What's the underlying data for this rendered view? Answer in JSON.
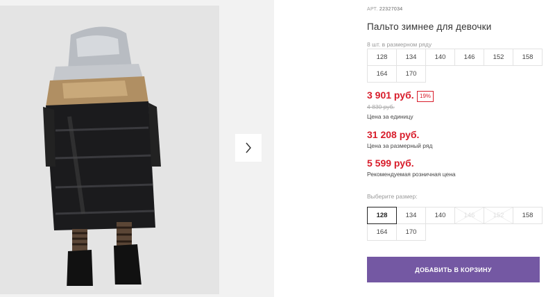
{
  "product": {
    "article_label": "АРТ.",
    "article_number": "22327034",
    "title": "Пальто зимнее для девочки"
  },
  "gallery": {
    "next_icon": "chevron-right-icon"
  },
  "pack": {
    "label": "8 шт. в размерном ряду",
    "sizes": [
      "128",
      "134",
      "140",
      "146",
      "152",
      "158",
      "164",
      "170"
    ]
  },
  "pricing": {
    "unit_price": "3 901 руб.",
    "discount": "19%",
    "old_price": "4 830 руб.",
    "unit_note": "Цена за единицу",
    "pack_price": "31 208 руб.",
    "pack_note": "Цена за размерный ряд",
    "retail_price": "5 599 руб.",
    "retail_note": "Рекомендуемая розничная цена"
  },
  "size_select": {
    "label": "Выберите размер:",
    "sizes": [
      {
        "label": "128",
        "state": "selected"
      },
      {
        "label": "134",
        "state": "available"
      },
      {
        "label": "140",
        "state": "available"
      },
      {
        "label": "146",
        "state": "disabled"
      },
      {
        "label": "152",
        "state": "disabled"
      },
      {
        "label": "158",
        "state": "available"
      },
      {
        "label": "164",
        "state": "available"
      },
      {
        "label": "170",
        "state": "available"
      }
    ]
  },
  "cart": {
    "button_label": "ДОБАВИТЬ В КОРЗИНУ"
  },
  "colors": {
    "price_red": "#d81c2a",
    "button_purple": "#7458a3"
  }
}
